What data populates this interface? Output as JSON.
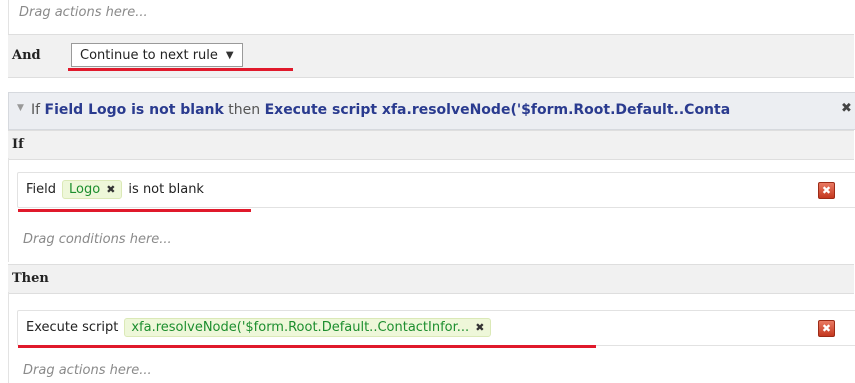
{
  "top": {
    "drag_actions_hint": "Drag actions here...",
    "and_label": "And",
    "and_dropdown_value": "Continue to next rule"
  },
  "rule": {
    "collapse_glyph": "▼",
    "if_word": "If",
    "condition_summary": "Field Logo is not blank",
    "then_word": "then",
    "action_summary": "Execute script xfa.resolveNode('$form.Root.Default..Conta",
    "close_glyph": "✖"
  },
  "if_section": {
    "label": "If",
    "condition": {
      "prefix": "Field",
      "chip_text": "Logo",
      "chip_remove": "✖",
      "suffix": "is not blank"
    },
    "drag_conditions_hint": "Drag conditions here..."
  },
  "then_section": {
    "label": "Then",
    "action": {
      "prefix": "Execute script",
      "chip_text": "xfa.resolveNode('$form.Root.Default..ContactInfor...",
      "chip_remove": "✖"
    },
    "drag_actions_hint": "Drag actions here..."
  },
  "icons": {
    "delete": "✖",
    "chevron": "⌄"
  },
  "colors": {
    "annotation_red": "#e0192b",
    "chip_green_text": "#1c8e2e",
    "rule_keyword_blue": "#2a3b8f"
  }
}
